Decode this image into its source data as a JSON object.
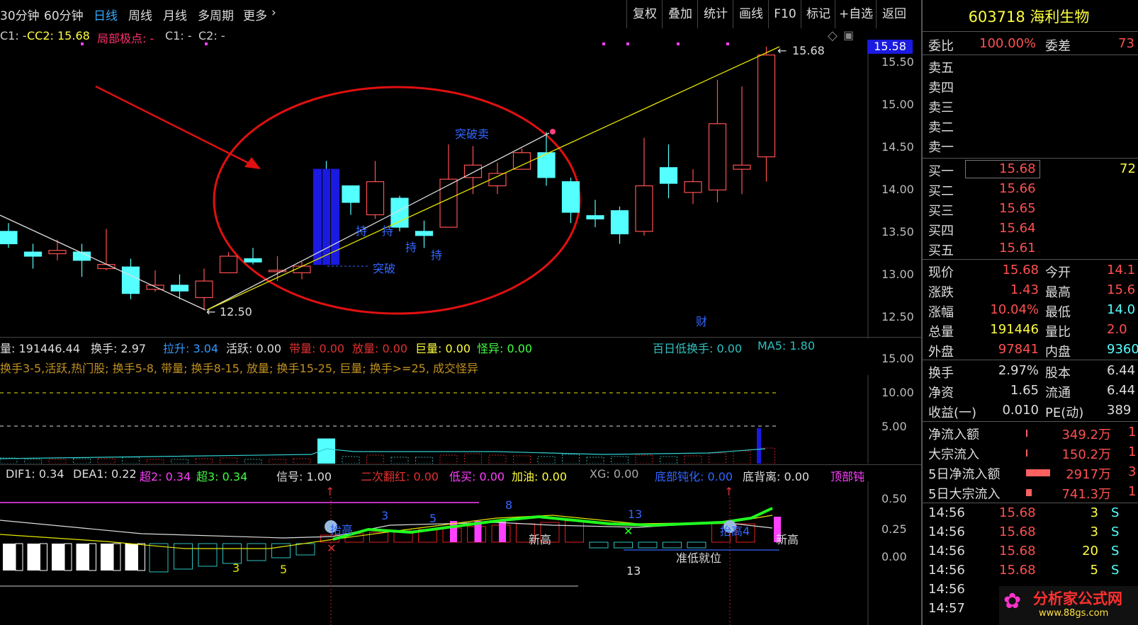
{
  "toolbar": {
    "periods": [
      "30分钟",
      "60分钟",
      "日线",
      "周线",
      "月线",
      "多周期",
      "更多"
    ],
    "active_period": "日线",
    "buttons": [
      "复权",
      "叠加",
      "统计",
      "画线",
      "F10",
      "标记",
      "+自选",
      "返回"
    ]
  },
  "main_info": {
    "c1": "C1: -",
    "cc2": "CC2: 15.68",
    "local_extreme": "局部极点: -",
    "c1b": "C1: -",
    "c2": "C2: -"
  },
  "main_chart": {
    "current_price_tag": "15.58",
    "high_label": "15.68",
    "low_label": "12.50",
    "axis_ticks": [
      "15.50",
      "15.00",
      "14.50",
      "14.00",
      "13.50",
      "13.00",
      "12.50"
    ],
    "annotations": {
      "breakout_sell": "突破卖",
      "breakout": "突破",
      "hold": "持",
      "cai": "财"
    }
  },
  "volume_panel": {
    "total_volume": "量: 191446.44",
    "turnover": "换手: 2.97",
    "lashen": "拉升: 3.04",
    "active": "活跃: 0.00",
    "band_volume": "带量: 0.00",
    "surge": "放量: 0.00",
    "huge": "巨量: 0.00",
    "odd": "怪异: 0.00",
    "low_turnover": "百日低换手: 0.00",
    "ma5": "MA5: 1.80",
    "legend": "换手3-5,活跃,热门股; 换手5-8, 带量; 换手8-15, 放量; 换手15-25, 巨量; 换手>=25, 成交怪异",
    "axis_ticks": [
      "15.00",
      "10.00",
      "5.00"
    ]
  },
  "macd_panel": {
    "dif1": "DIF1: 0.34",
    "dea1": "DEA1: 0.22",
    "chao2": "超2: 0.34",
    "chao3": "超3: 0.34",
    "signal": "信号: 1.00",
    "second_red": "二次翻红: 0.00",
    "low_buy": "低买: 0.00",
    "refuel": "加油: 0.00",
    "xg": "XG: 0.00",
    "bottom_blunt": "底部钝化: 0.00",
    "bottom_div": "底背离: 0.00",
    "top_blunt": "顶部钝",
    "axis_ticks": [
      "0.50",
      "0.25",
      "0.00"
    ],
    "annotations": [
      "抬高",
      "3",
      "5",
      "8",
      "新高",
      "13",
      "抬高4",
      "新高",
      "3",
      "5",
      "13",
      "准低就位"
    ]
  },
  "quote": {
    "code": "603718",
    "name": "海利生物",
    "wei_bi_label": "委比",
    "wei_bi": "100.00%",
    "wei_cha_label": "委差",
    "wei_cha": "73",
    "sells": [
      {
        "label": "卖五",
        "price": "",
        "vol": ""
      },
      {
        "label": "卖四",
        "price": "",
        "vol": ""
      },
      {
        "label": "卖三",
        "price": "",
        "vol": ""
      },
      {
        "label": "卖二",
        "price": "",
        "vol": ""
      },
      {
        "label": "卖一",
        "price": "",
        "vol": ""
      }
    ],
    "buys": [
      {
        "label": "买一",
        "price": "15.68",
        "vol": "72"
      },
      {
        "label": "买二",
        "price": "15.66",
        "vol": ""
      },
      {
        "label": "买三",
        "price": "15.65",
        "vol": ""
      },
      {
        "label": "买四",
        "price": "15.64",
        "vol": ""
      },
      {
        "label": "买五",
        "price": "15.61",
        "vol": ""
      }
    ],
    "stats": [
      {
        "l1": "现价",
        "v1": "15.68",
        "l2": "今开",
        "v2": "14.1"
      },
      {
        "l1": "涨跌",
        "v1": "1.43",
        "l2": "最高",
        "v2": "15.6"
      },
      {
        "l1": "涨幅",
        "v1": "10.04%",
        "l2": "最低",
        "v2": "14.0"
      },
      {
        "l1": "总量",
        "v1": "191446",
        "l2": "量比",
        "v2": "2.0"
      },
      {
        "l1": "外盘",
        "v1": "97841",
        "l2": "内盘",
        "v2": "9360"
      }
    ],
    "fundamentals": [
      {
        "l1": "换手",
        "v1": "2.97%",
        "l2": "股本",
        "v2": "6.44"
      },
      {
        "l1": "净资",
        "v1": "1.65",
        "l2": "流通",
        "v2": "6.44"
      },
      {
        "l1": "收益(一)",
        "v1": "0.010",
        "l2": "PE(动)",
        "v2": "389"
      }
    ],
    "flows": [
      {
        "label": "净流入额",
        "value": "349.2万",
        "extra": "1"
      },
      {
        "label": "大宗流入",
        "value": "150.2万",
        "extra": "1"
      },
      {
        "label": "5日净流入额",
        "value": "2917万",
        "extra": "3"
      },
      {
        "label": "5日大宗流入",
        "value": "741.3万",
        "extra": "1"
      }
    ],
    "ticks": [
      {
        "time": "14:56",
        "price": "15.68",
        "vol": "3",
        "side": "S"
      },
      {
        "time": "14:56",
        "price": "15.68",
        "vol": "3",
        "side": "S"
      },
      {
        "time": "14:56",
        "price": "15.68",
        "vol": "20",
        "side": "S"
      },
      {
        "time": "14:56",
        "price": "15.68",
        "vol": "5",
        "side": "S"
      },
      {
        "time": "14:56",
        "price": "",
        "vol": "",
        "side": ""
      },
      {
        "time": "14:57",
        "price": "",
        "vol": "",
        "side": ""
      }
    ]
  },
  "watermark": {
    "text": "分析家公式网",
    "url": "www.88gs.com"
  },
  "colors": {
    "up": "#ff5050",
    "down": "#54ffff",
    "ma_line": "#ffff00",
    "circle": "#e01010",
    "accent_blue": "#3399ff"
  },
  "chart_data": {
    "type": "candlestick",
    "ylim": [
      12.3,
      15.8
    ],
    "candles": [
      {
        "o": 13.45,
        "c": 13.3,
        "h": 13.55,
        "l": 13.25
      },
      {
        "o": 13.2,
        "c": 13.15,
        "h": 13.3,
        "l": 13.0
      },
      {
        "o": 13.18,
        "c": 13.22,
        "h": 13.35,
        "l": 13.1
      },
      {
        "o": 13.2,
        "c": 13.1,
        "h": 13.3,
        "l": 12.9
      },
      {
        "o": 13.0,
        "c": 13.05,
        "h": 13.48,
        "l": 12.98
      },
      {
        "o": 13.02,
        "c": 12.7,
        "h": 13.12,
        "l": 12.63
      },
      {
        "o": 12.75,
        "c": 12.8,
        "h": 12.98,
        "l": 12.72
      },
      {
        "o": 12.8,
        "c": 12.73,
        "h": 12.93,
        "l": 12.63
      },
      {
        "o": 12.65,
        "c": 12.85,
        "h": 13.0,
        "l": 12.5
      },
      {
        "o": 12.95,
        "c": 13.15,
        "h": 13.2,
        "l": 12.95
      },
      {
        "o": 13.12,
        "c": 13.08,
        "h": 13.25,
        "l": 13.05
      },
      {
        "o": 12.98,
        "c": 12.98,
        "h": 13.15,
        "l": 12.85
      },
      {
        "o": 12.95,
        "c": 13.03,
        "h": 13.08,
        "l": 12.87
      },
      {
        "o": 14.2,
        "c": 13.05,
        "h": 14.3,
        "l": 13.05
      },
      {
        "o": 14.0,
        "c": 13.8,
        "h": 14.0,
        "l": 13.65
      },
      {
        "o": 13.65,
        "c": 14.05,
        "h": 14.3,
        "l": 13.6
      },
      {
        "o": 13.85,
        "c": 13.5,
        "h": 13.88,
        "l": 13.45
      },
      {
        "o": 13.45,
        "c": 13.4,
        "h": 13.58,
        "l": 13.25
      },
      {
        "o": 13.5,
        "c": 14.08,
        "h": 14.5,
        "l": 13.5
      },
      {
        "o": 14.1,
        "c": 14.25,
        "h": 14.48,
        "l": 13.9
      },
      {
        "o": 14.0,
        "c": 14.15,
        "h": 14.28,
        "l": 13.9
      },
      {
        "o": 14.2,
        "c": 14.4,
        "h": 14.45,
        "l": 14.2
      },
      {
        "o": 14.4,
        "c": 14.1,
        "h": 14.65,
        "l": 14.0
      },
      {
        "o": 14.05,
        "c": 13.68,
        "h": 14.1,
        "l": 13.55
      },
      {
        "o": 13.64,
        "c": 13.6,
        "h": 13.83,
        "l": 13.5
      },
      {
        "o": 13.7,
        "c": 13.42,
        "h": 13.75,
        "l": 13.3
      },
      {
        "o": 13.45,
        "c": 14.0,
        "h": 14.58,
        "l": 13.4
      },
      {
        "o": 14.22,
        "c": 14.03,
        "h": 14.5,
        "l": 13.85
      },
      {
        "o": 13.92,
        "c": 14.05,
        "h": 14.2,
        "l": 13.78
      },
      {
        "o": 13.95,
        "c": 14.75,
        "h": 15.28,
        "l": 13.8
      },
      {
        "o": 14.2,
        "c": 14.25,
        "h": 15.2,
        "l": 13.9
      },
      {
        "o": 14.35,
        "c": 15.58,
        "h": 15.68,
        "l": 14.05
      }
    ]
  }
}
